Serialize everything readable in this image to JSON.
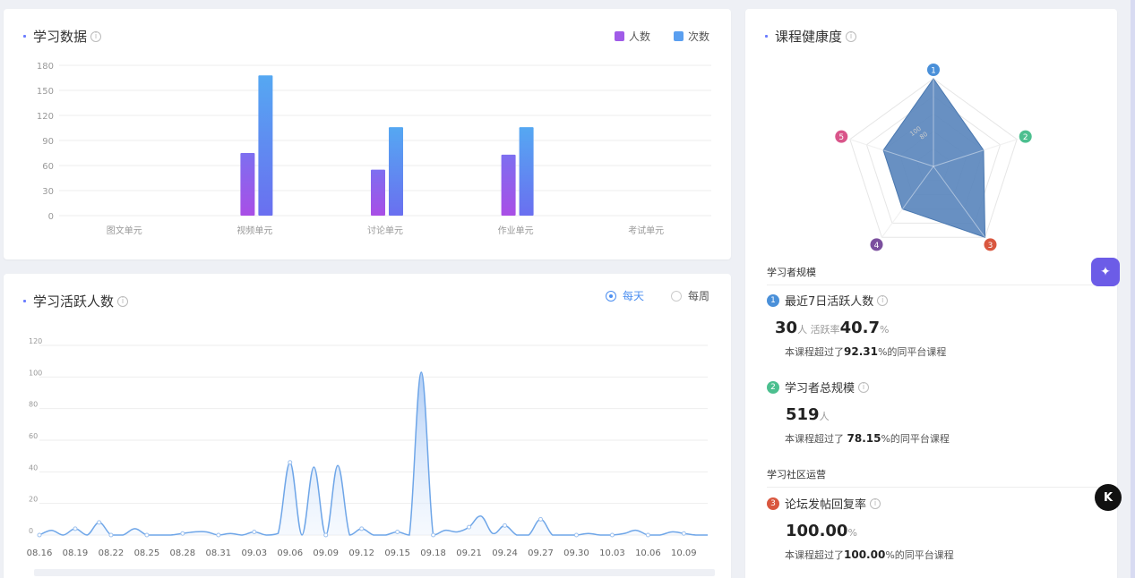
{
  "learning_data": {
    "title": "学习数据",
    "legend": [
      {
        "label": "人数",
        "color": "#a05be8"
      },
      {
        "label": "次数",
        "color": "#5a9ff0"
      }
    ]
  },
  "active_users": {
    "title": "学习活跃人数",
    "options": [
      {
        "label": "每天",
        "checked": true
      },
      {
        "label": "每周",
        "checked": false
      }
    ]
  },
  "health": {
    "title": "课程健康度",
    "radar_labels": [
      "1",
      "2",
      "3",
      "4",
      "5"
    ],
    "radar_colors": [
      "#4a90d9",
      "#4cbf8f",
      "#d9573f",
      "#7b4f9e",
      "#d9558a"
    ],
    "radar_values": [
      100,
      60,
      100,
      60,
      60
    ],
    "radar_ticks": [
      "100",
      "80"
    ],
    "section1": "学习者规模",
    "m1": {
      "num": "1",
      "title": "最近7日活跃人数",
      "value": "30",
      "unit": "人",
      "rate_label": "活跃率",
      "rate": "40.7",
      "rate_unit": "%",
      "desc_pre": "本课程超过了",
      "desc_val": "92.31",
      "desc_post": "%的同平台课程"
    },
    "m2": {
      "num": "2",
      "title": "学习者总规模",
      "value": "519",
      "unit": "人",
      "desc_pre": "本课程超过了 ",
      "desc_val": "78.15",
      "desc_post": "%的同平台课程"
    },
    "section2": "学习社区运营",
    "m3": {
      "num": "3",
      "title": "论坛发帖回复率",
      "value": "100.00",
      "unit": "%",
      "desc_pre": "本课程超过了",
      "desc_val": "100.00",
      "desc_post": "%的同平台课程"
    }
  },
  "chart_data": [
    {
      "type": "bar",
      "categories": [
        "图文单元",
        "视频单元",
        "讨论单元",
        "作业单元",
        "考试单元"
      ],
      "series": [
        {
          "name": "人数",
          "values": [
            0,
            75,
            55,
            73,
            0
          ]
        },
        {
          "name": "次数",
          "values": [
            0,
            168,
            106,
            106,
            0
          ]
        }
      ],
      "yticks": [
        "0",
        "30",
        "60",
        "90",
        "120",
        "150",
        "180"
      ],
      "ylim": [
        0,
        180
      ]
    },
    {
      "type": "area",
      "x": [
        "08.16",
        "08.17",
        "08.18",
        "08.19",
        "08.20",
        "08.21",
        "08.22",
        "08.23",
        "08.24",
        "08.25",
        "08.26",
        "08.27",
        "08.28",
        "08.29",
        "08.30",
        "08.31",
        "09.01",
        "09.02",
        "09.03",
        "09.04",
        "09.05",
        "09.06",
        "09.07",
        "09.08",
        "09.09",
        "09.10",
        "09.11",
        "09.12",
        "09.13",
        "09.14",
        "09.15",
        "09.16",
        "09.17",
        "09.18",
        "09.19",
        "09.20",
        "09.21",
        "09.22",
        "09.23",
        "09.24",
        "09.25",
        "09.26",
        "09.27",
        "09.28",
        "09.29",
        "09.30",
        "10.01",
        "10.02",
        "10.03",
        "10.04",
        "10.05",
        "10.06",
        "10.07",
        "10.08",
        "10.09",
        "10.10",
        "10.11"
      ],
      "xticks": [
        "08.16",
        "08.19",
        "08.22",
        "08.25",
        "08.28",
        "08.31",
        "09.03",
        "09.06",
        "09.09",
        "09.12",
        "09.15",
        "09.18",
        "09.21",
        "09.24",
        "09.27",
        "09.30",
        "10.03",
        "10.06",
        "10.09"
      ],
      "values": [
        0,
        3,
        0,
        4,
        0,
        8,
        0,
        0,
        4,
        0,
        0,
        0,
        1,
        2,
        2,
        0,
        1,
        0,
        2,
        0,
        1,
        46,
        0,
        43,
        0,
        44,
        0,
        4,
        0,
        0,
        2,
        0,
        103,
        0,
        3,
        2,
        5,
        12,
        1,
        6,
        0,
        0,
        10,
        0,
        0,
        0,
        1,
        0,
        0,
        1,
        3,
        0,
        0,
        2,
        1,
        0,
        0
      ],
      "yticks": [
        "0",
        "20",
        "40",
        "60",
        "80",
        "100",
        "120"
      ],
      "ylim": [
        0,
        120
      ]
    }
  ],
  "colors": {
    "accent": "#4d8ff0",
    "area_fill": "#d6e6fb",
    "radar_fill": "#5b87bd"
  }
}
